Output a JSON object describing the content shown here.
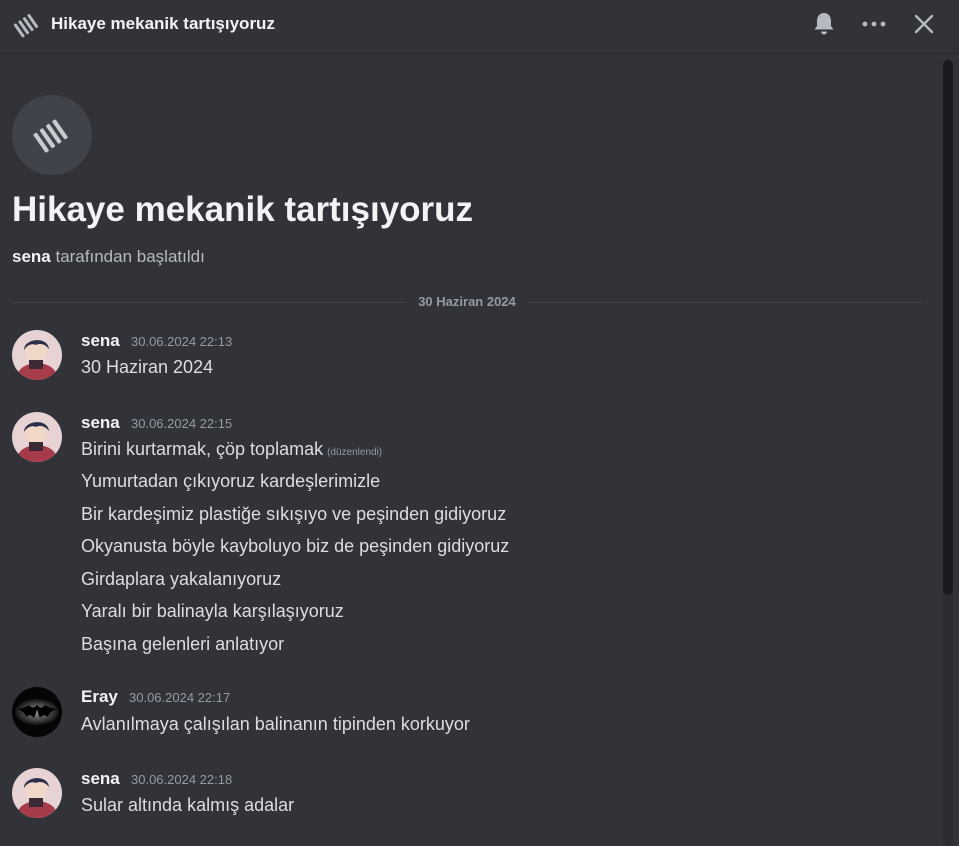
{
  "header": {
    "title": "Hikaye mekanik tartışıyoruz",
    "thread_icon": "thread-icon",
    "bell_icon": "bell-icon",
    "more_icon": "more-dots-icon",
    "close_icon": "close-icon"
  },
  "intro": {
    "title": "Hikaye mekanik tartışıyoruz",
    "started_by": "sena",
    "started_suffix": " tarafından başlatıldı"
  },
  "date_divider": "30 Haziran 2024",
  "messages": [
    {
      "author": "sena",
      "time": "30.06.2024 22:13",
      "lines": [
        "30 Haziran 2024"
      ]
    },
    {
      "author": "sena",
      "time": "30.06.2024 22:15",
      "edited": "(düzenlendi)",
      "lines": [
        "Birini kurtarmak, çöp toplamak",
        "Yumurtadan çıkıyoruz kardeşlerimizle",
        "Bir kardeşimiz plastiğe sıkışıyo ve peşinden gidiyoruz",
        "Okyanusta böyle kayboluyo biz de peşinden gidiyoruz",
        "Girdaplara yakalanıyoruz",
        "Yaralı bir balinayla karşılaşıyoruz",
        "Başına gelenleri anlatıyor"
      ]
    },
    {
      "author": "Eray",
      "time": "30.06.2024 22:17",
      "lines": [
        "Avlanılmaya çalışılan balinanın tipinden korkuyor"
      ]
    },
    {
      "author": "sena",
      "time": "30.06.2024 22:18",
      "lines": [
        "Sular altında kalmış adalar"
      ]
    }
  ],
  "colors": {
    "background": "#313338",
    "text": "#dbdee1",
    "muted": "#949ba4",
    "heading": "#f2f3f5"
  }
}
